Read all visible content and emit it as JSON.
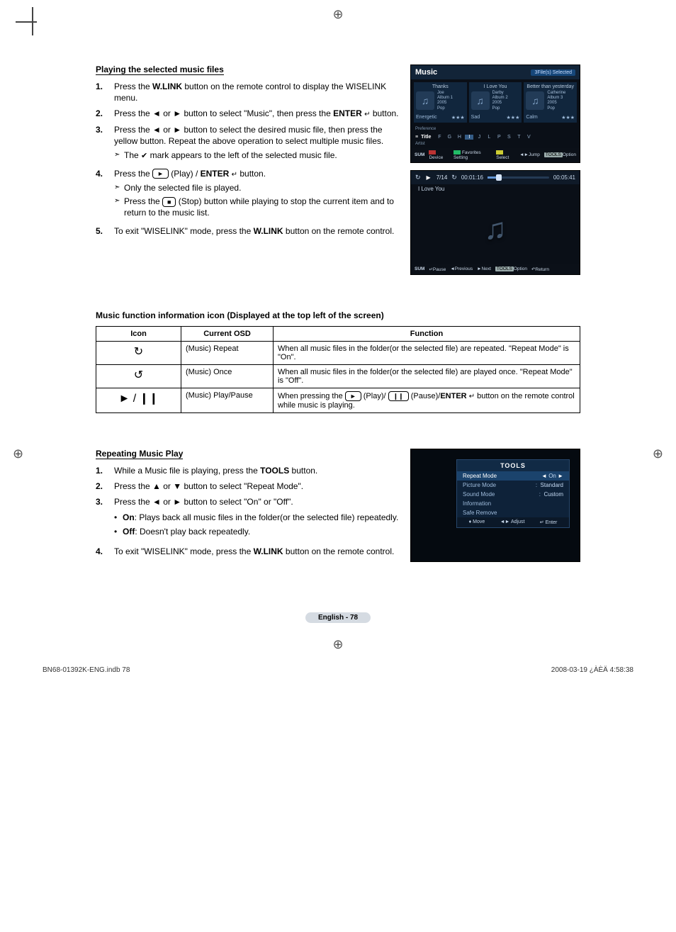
{
  "section1": {
    "heading": "Playing the selected music files",
    "steps": [
      {
        "n": "1.",
        "pre": "Press the ",
        "bold": "W.LINK",
        "post": " button on the remote control to display the WISELINK menu."
      },
      {
        "n": "2.",
        "text": "Press the ◄ or ► button to select \"Music\", then press the ",
        "bold": "ENTER",
        "icon": "↵",
        "post": " button."
      },
      {
        "n": "3.",
        "text": "Press the ◄ or ► button to select the desired music file, then press the yellow button. Repeat the above operation to select multiple music files.",
        "sub": [
          "The ✔ mark appears to the left of the selected music file."
        ]
      },
      {
        "n": "4.",
        "pre": "Press the ",
        "btn": "►",
        "mid": " (Play) / ",
        "bold": "ENTER",
        "icon": "↵",
        "post": " button.",
        "sub": [
          "Only the selected file is played.",
          "Press the ▢■ (Stop) button while playing to stop the current item and to return to the music list."
        ]
      },
      {
        "n": "5.",
        "pre": "To exit \"WISELINK\" mode, press the ",
        "bold": "W.LINK",
        "post": " button on the remote control."
      }
    ]
  },
  "check_mark_note": "The ✔ mark appears to the left of the selected music file.",
  "shot_music": {
    "title": "Music",
    "badge": "3File(s) Selected",
    "cells": [
      {
        "song": "Thanks",
        "artist": "Joe",
        "album": "Album 1",
        "year": "2005",
        "genre": "Pop",
        "mood": "Energetic"
      },
      {
        "song": "I Love You",
        "artist": "Darby",
        "album": "Album 2",
        "year": "2005",
        "genre": "Pop",
        "mood": "Sad"
      },
      {
        "song": "Better than yesterday",
        "artist": "Catherine",
        "album": "Album 3",
        "year": "2005",
        "genre": "Pop",
        "mood": "Calm"
      }
    ],
    "pref": "Preference",
    "sort_label": "Title",
    "sort_keys": [
      "F",
      "G",
      "H",
      "I",
      "J",
      "L",
      "P",
      "S",
      "T",
      "V"
    ],
    "artist": "Artist",
    "hints": {
      "sum": "SUM",
      "device": "Device",
      "fav": "Favorites Setting",
      "select": "Select",
      "jump": "Jump",
      "tools": "TOOLS",
      "option": "Option"
    }
  },
  "shot_play": {
    "count": "7/14",
    "elapsed": "00:01:16",
    "total": "00:05:41",
    "title": "I Love You",
    "hints": {
      "sum": "SUM",
      "pause": "Pause",
      "prev": "Previous",
      "next": "Next",
      "tools": "TOOLS",
      "option": "Option",
      "return": "Return"
    }
  },
  "table_heading": "Music function information icon (Displayed at the top left of the screen)",
  "table": {
    "headers": [
      "Icon",
      "Current OSD",
      "Function"
    ],
    "rows": [
      {
        "icon": "↻",
        "osd": "(Music) Repeat",
        "fn": "When all music files in the folder(or the selected file) are repeated. \"Repeat Mode\" is \"On\"."
      },
      {
        "icon": "↺",
        "osd": "(Music) Once",
        "fn": "When all music files in the folder(or the selected file) are played once. \"Repeat Mode\" is \"Off\"."
      },
      {
        "icon": "► / ❙❙",
        "osd": "(Music) Play/Pause",
        "fn": "When pressing the ▭► (Play)/ ▭❙❙ (Pause)/ENTER ↵ button on the remote control while music is playing."
      }
    ]
  },
  "section2": {
    "heading": "Repeating Music Play",
    "steps": [
      {
        "n": "1.",
        "pre": "While a Music file is playing, press the ",
        "bold": "TOOLS",
        "post": " button."
      },
      {
        "n": "2.",
        "text": "Press the ▲ or ▼ button to select \"Repeat Mode\"."
      },
      {
        "n": "3.",
        "text": "Press the ◄ or ► button to select \"On\" or \"Off\".",
        "bullets": [
          {
            "b": "On",
            "t": ": Plays back all music files in the folder(or the selected file) repeatedly."
          },
          {
            "b": "Off",
            "t": ": Doesn't play back repeatedly."
          }
        ]
      },
      {
        "n": "4.",
        "pre": "To exit \"WISELINK\" mode, press the ",
        "bold": "W.LINK",
        "post": " button on the remote control."
      }
    ]
  },
  "tools": {
    "title": "TOOLS",
    "rows": [
      {
        "label": "Repeat Mode",
        "value": "On",
        "active": true
      },
      {
        "label": "Picture Mode",
        "sep": ":",
        "value": "Standard"
      },
      {
        "label": "Sound Mode",
        "sep": ":",
        "value": "Custom"
      },
      {
        "label": "Information"
      },
      {
        "label": "Safe Remove"
      }
    ],
    "foot": {
      "move": "Move",
      "adjust": "Adjust",
      "enter": "Enter"
    }
  },
  "page_label": "English - 78",
  "footer_left": "BN68-01392K-ENG.indb   78",
  "footer_right": "2008-03-19   ¿ÀÈÄ 4:58:38"
}
